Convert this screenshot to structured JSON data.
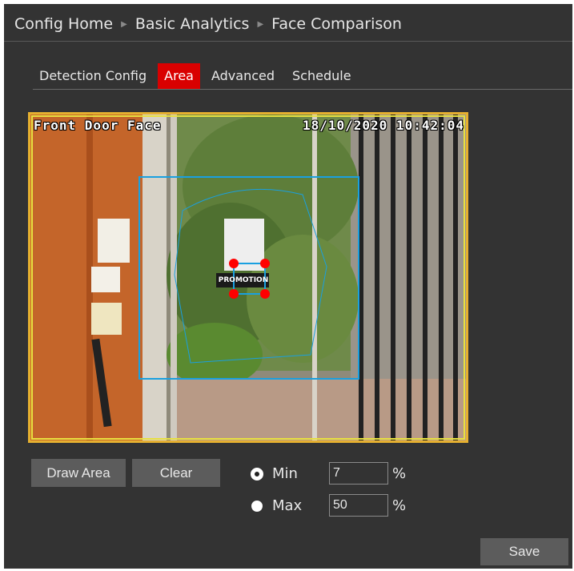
{
  "breadcrumb": [
    "Config Home",
    "Basic Analytics",
    "Face Comparison"
  ],
  "tabs": [
    {
      "label": "Detection Config",
      "active": false
    },
    {
      "label": "Area",
      "active": true
    },
    {
      "label": "Advanced",
      "active": false
    },
    {
      "label": "Schedule",
      "active": false
    }
  ],
  "video": {
    "osd_left": "Front Door Face",
    "osd_right": "18/10/2020 10:42:04",
    "sign_text": "PROMOTION"
  },
  "actions": {
    "draw_area": "Draw Area",
    "clear": "Clear",
    "save": "Save"
  },
  "size": {
    "min_label": "Min",
    "min_value": "7",
    "max_label": "Max",
    "max_value": "50",
    "unit": "%",
    "selected": "Min"
  },
  "colors": {
    "active_tab": "#d90000",
    "area_border": "#e6b030",
    "detection_box": "#1aa0e0",
    "handle": "#ff0000"
  }
}
